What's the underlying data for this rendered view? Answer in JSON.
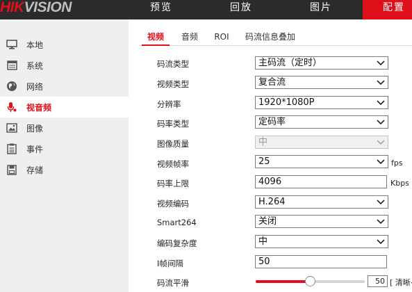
{
  "brand": {
    "hik": "HIK",
    "vision": "VISION"
  },
  "nav": [
    {
      "label": "预览"
    },
    {
      "label": "回放"
    },
    {
      "label": "图片"
    },
    {
      "label": "配置"
    }
  ],
  "sidebar": [
    {
      "label": "本地",
      "icon": "monitor-icon"
    },
    {
      "label": "系统",
      "icon": "system-icon"
    },
    {
      "label": "网络",
      "icon": "globe-icon"
    },
    {
      "label": "视音频",
      "icon": "microphone-icon",
      "active": true
    },
    {
      "label": "图像",
      "icon": "image-icon"
    },
    {
      "label": "事件",
      "icon": "event-list-icon"
    },
    {
      "label": "存储",
      "icon": "storage-icon"
    }
  ],
  "tabs": [
    {
      "label": "视频",
      "active": true
    },
    {
      "label": "音频"
    },
    {
      "label": "ROI"
    },
    {
      "label": "码流信息叠加"
    }
  ],
  "form": {
    "stream_type": {
      "label": "码流类型",
      "value": "主码流（定时）"
    },
    "video_type": {
      "label": "视频类型",
      "value": "复合流"
    },
    "resolution": {
      "label": "分辨率",
      "value": "1920*1080P"
    },
    "bitrate_type": {
      "label": "码率类型",
      "value": "定码率"
    },
    "image_quality": {
      "label": "图像质量",
      "value": "中",
      "disabled": true
    },
    "frame_rate": {
      "label": "视频帧率",
      "value": "25",
      "unit": "fps"
    },
    "max_bitrate": {
      "label": "码率上限",
      "value": "4096",
      "unit": "Kbps"
    },
    "video_encoding": {
      "label": "视频编码",
      "value": "H.264"
    },
    "smart264": {
      "label": "Smart264",
      "value": "关闭"
    },
    "encoding_complexity": {
      "label": "编码复杂度",
      "value": "中"
    },
    "i_frame_interval": {
      "label": "I帧间隔",
      "value": "50"
    },
    "stream_smoothing": {
      "label": "码流平滑",
      "value": "50",
      "note": "[ 清晰<"
    }
  },
  "colors": {
    "accent": "#e0101b",
    "topbar": "#2b2b2b",
    "sidebar": "#efefef"
  }
}
